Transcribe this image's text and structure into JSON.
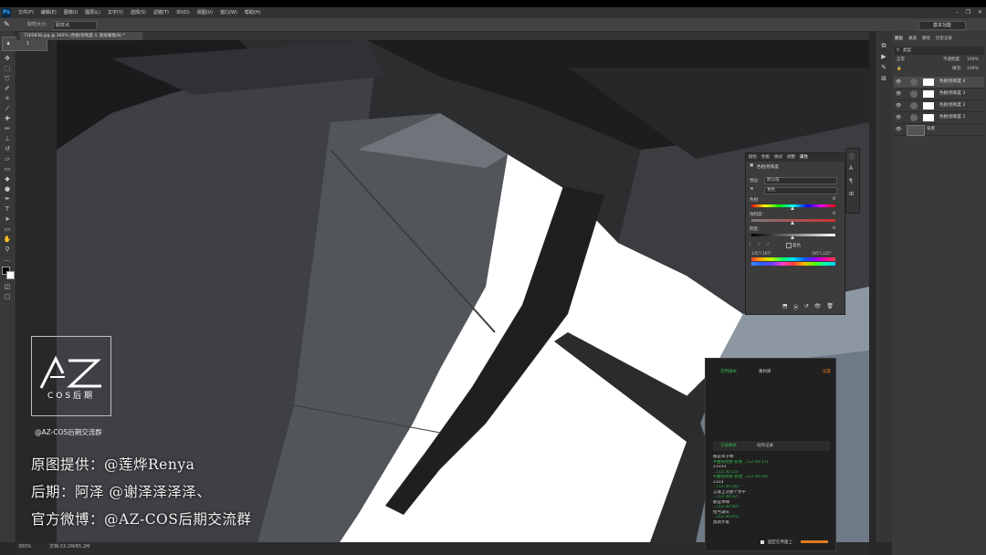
{
  "app": {
    "logo": "Ps",
    "menus": [
      "文件(F)",
      "编辑(E)",
      "图像(I)",
      "图层(L)",
      "文字(Y)",
      "选择(S)",
      "滤镜(T)",
      "3D(D)",
      "视图(V)",
      "窗口(W)",
      "帮助(H)"
    ],
    "window_controls": [
      "–",
      "❐",
      "✕"
    ]
  },
  "options_bar": {
    "label": "取样大小:",
    "sample_size": "取样点",
    "workspace": "基本功能"
  },
  "brush_popup": {
    "value": "1"
  },
  "document_tab": {
    "title": "7160838.jpg @ 300% (色相/饱和度 4, 图层蒙版/8) *"
  },
  "status_bar": {
    "zoom": "300%",
    "doc_info": "文档:33.1M/65.2M"
  },
  "watermark": {
    "logo_text": "AZ",
    "cos_label": "COS后期",
    "group": "@AZ-COS后期交流群"
  },
  "credits": [
    "原图提供：@莲烨Renya",
    "后期：阿泽 @谢泽泽泽泽、",
    "官方微博：@AZ-COS后期交流群"
  ],
  "layers_panel": {
    "tabs": [
      "图层",
      "通道",
      "路径",
      "历史记录"
    ],
    "filter": "类型",
    "blend_mode": "正常",
    "opacity_label": "不透明度:",
    "opacity": "100%",
    "fill_label": "填充:",
    "fill": "100%",
    "layers": [
      {
        "name": "色相/饱和度 4",
        "selected": true
      },
      {
        "name": "色相/饱和度 3",
        "selected": false
      },
      {
        "name": "色相/饱和度 2",
        "selected": false
      },
      {
        "name": "色相/饱和度 1",
        "selected": false
      },
      {
        "name": "背景",
        "selected": false
      }
    ]
  },
  "properties_panel": {
    "tabs": [
      "颜色",
      "色板",
      "样式",
      "调整",
      "属性"
    ],
    "title": "色相/饱和度",
    "preset_label": "预设:",
    "preset": "默认值",
    "channel": "青色",
    "hue_label": "色相:",
    "hue": "0",
    "saturation_label": "饱和度:",
    "saturation": "0",
    "lightness_label": "明度:",
    "lightness": "0",
    "colorize_label": "着色",
    "range_left": "135°/ 165°",
    "range_right": "195°\\ 225°"
  },
  "plugin_panel": {
    "tab_left": "常用脚本",
    "tab_mid": "素材库",
    "tab_right": "设置",
    "sub_tab_left": "记录脚本",
    "sub_tab_right": "动作记录",
    "log": [
      {
        "text": "都是笨子啊",
        "color": "w"
      },
      {
        "text": "#曲线调整  新建...(12:30:11)",
        "color": "g"
      },
      {
        "text": "23333",
        "color": "w"
      },
      {
        "text": "  ...(12:30:15)",
        "color": "g"
      },
      {
        "text": "#曲线调整  新建...(12:30:20)",
        "color": "g"
      },
      {
        "text": "2333",
        "color": "w"
      },
      {
        "text": "  ...(12:30:26)",
        "color": "g"
      },
      {
        "text": "言取上次那个水平",
        "color": "w"
      },
      {
        "text": "  ...(12:30:32)",
        "color": "g"
      },
      {
        "text": "那是木呐",
        "color": "w"
      },
      {
        "text": "  ...(12:30:40)",
        "color": "g"
      },
      {
        "text": "拉弓满头",
        "color": "w"
      },
      {
        "text": "  ...(12:30:45)",
        "color": "g"
      },
      {
        "text": "奥斯大家",
        "color": "w"
      }
    ],
    "footer": "固定在界面上"
  },
  "colors": {
    "accent_green": "#34b34a",
    "ps_blue": "#31a8ff",
    "orange": "#e07a1f"
  }
}
